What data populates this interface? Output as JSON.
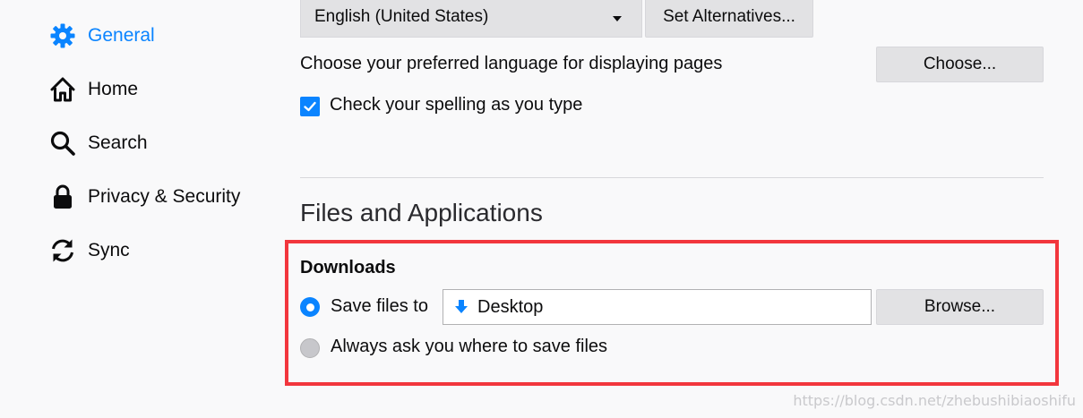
{
  "sidebar": {
    "items": [
      {
        "label": "General",
        "icon": "gear-icon",
        "selected": true
      },
      {
        "label": "Home",
        "icon": "home-icon"
      },
      {
        "label": "Search",
        "icon": "search-icon"
      },
      {
        "label": "Privacy & Security",
        "icon": "lock-icon"
      },
      {
        "label": "Sync",
        "icon": "sync-icon"
      }
    ]
  },
  "language": {
    "selected_value": "English (United States)",
    "alternatives_button": "Set Alternatives...",
    "pages_label": "Choose your preferred language for displaying pages",
    "choose_button": "Choose...",
    "spelling_label": "Check your spelling as you type",
    "spelling_checked": true
  },
  "files_apps": {
    "title": "Files and Applications"
  },
  "downloads": {
    "title": "Downloads",
    "save_files_label": "Save files to",
    "save_path": "Desktop",
    "browse_button": "Browse...",
    "always_ask_label": "Always ask you where to save files",
    "selected_option": "save_files_to"
  },
  "watermark": "https://blog.csdn.net/zhebushibiaoshifu",
  "colors": {
    "accent": "#0a84ff",
    "highlight_border": "#f2363d",
    "background": "#f9f9fa"
  }
}
